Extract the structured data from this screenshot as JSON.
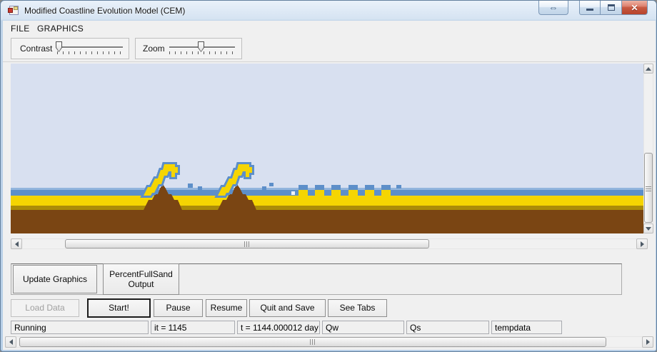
{
  "window": {
    "title": "Modified Coastline Evolution Model (CEM)",
    "caption_buttons": {
      "resize_glyph": "⇔",
      "close_glyph": "✕"
    }
  },
  "menu_bar": {
    "items": [
      {
        "label": "FILE"
      },
      {
        "label": "GRAPHICS"
      }
    ]
  },
  "toolbar": {
    "contrast": {
      "label": "Contrast",
      "value_percent": 4
    },
    "zoom": {
      "label": "Zoom",
      "value_percent": 48
    }
  },
  "canvas": {
    "description": "pixelated coastline simulation view",
    "colors": {
      "sky": "#d8e0f0",
      "water": "#5d8fc9",
      "water_light": "#93b5dd",
      "sand": "#f5d502",
      "sand_dark": "#ab8c09",
      "earth": "#7a4513",
      "foam": "#f0f3f8"
    }
  },
  "graphics_panel": {
    "buttons": [
      {
        "label": "Update Graphics"
      },
      {
        "label": "PercentFullSand Output"
      }
    ]
  },
  "action_buttons": [
    {
      "label": "Load Data",
      "state": "disabled"
    },
    {
      "label": "Start!",
      "state": "default"
    },
    {
      "label": "Pause",
      "state": "normal"
    },
    {
      "label": "Resume",
      "state": "normal"
    },
    {
      "label": "Quit and Save",
      "state": "normal"
    },
    {
      "label": "See Tabs",
      "state": "normal"
    }
  ],
  "status_bar": {
    "fields": [
      {
        "label": "Running"
      },
      {
        "label": "it = 1145"
      },
      {
        "label": "t = 1144.000012 day"
      },
      {
        "label": "Qw"
      },
      {
        "label": "Qs"
      },
      {
        "label": "tempdata"
      }
    ]
  }
}
